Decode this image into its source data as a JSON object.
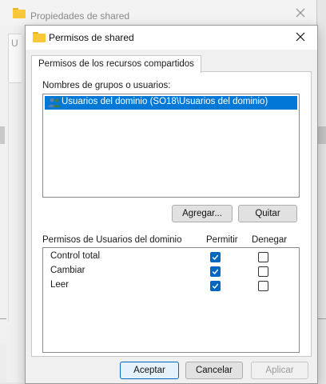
{
  "background_window": {
    "title": "Propiedades de shared",
    "partial_text": "U"
  },
  "dialog": {
    "title": "Permisos de shared",
    "tab_label": "Permisos de los recursos compartidos",
    "groups": {
      "label": "Nombres de grupos o usuarios:",
      "items": [
        {
          "label": "Usuarios del dominio (SO18\\Usuarios del dominio)",
          "selected": true,
          "icon": "users-group-icon"
        }
      ]
    },
    "add_label": "Agregar...",
    "remove_label": "Quitar",
    "permissions": {
      "label": "Permisos de Usuarios del dominio",
      "allow_header": "Permitir",
      "deny_header": "Denegar",
      "rows": [
        {
          "label": "Control total",
          "allow": true,
          "deny": false
        },
        {
          "label": "Cambiar",
          "allow": true,
          "deny": false
        },
        {
          "label": "Leer",
          "allow": true,
          "deny": false
        }
      ]
    },
    "ok_label": "Aceptar",
    "cancel_label": "Cancelar",
    "apply_label": "Aplicar",
    "apply_enabled": false
  },
  "colors": {
    "accent": "#0078d7",
    "checkbox_checked": "#0067c0",
    "folder": "#f8c83a"
  }
}
